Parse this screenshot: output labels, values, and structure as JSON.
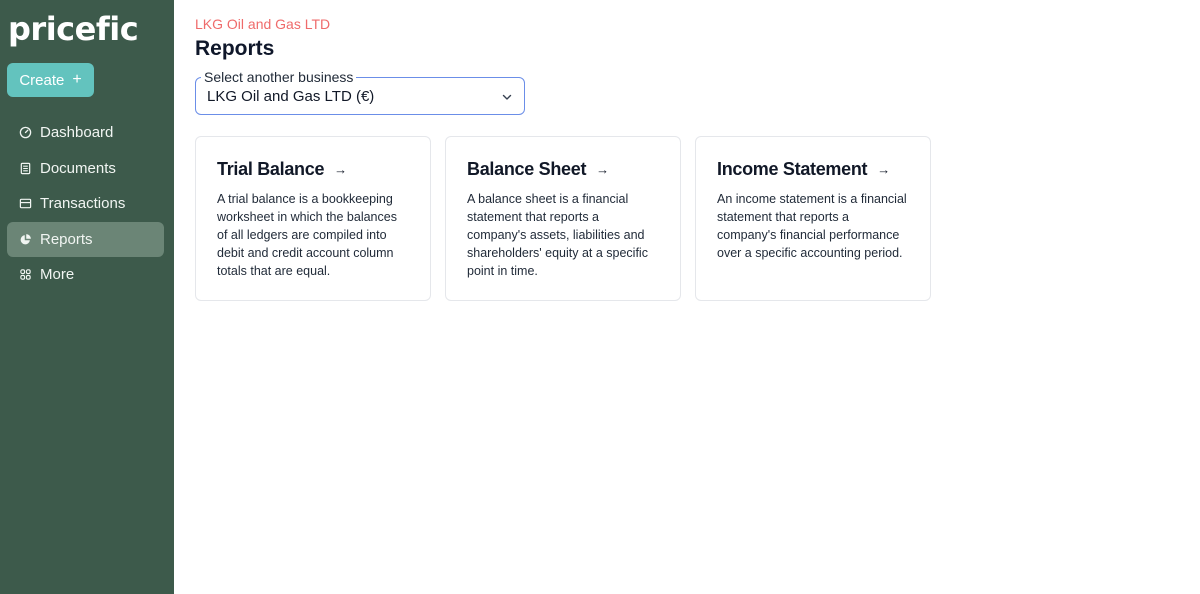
{
  "sidebar": {
    "logo": "pricefic",
    "create_label": "Create",
    "create_icon": "plus-icon",
    "items": [
      {
        "label": "Dashboard",
        "icon": "dashboard-gauge-icon",
        "active": false
      },
      {
        "label": "Documents",
        "icon": "document-icon",
        "active": false
      },
      {
        "label": "Transactions",
        "icon": "card-icon",
        "active": false
      },
      {
        "label": "Reports",
        "icon": "pie-chart-icon",
        "active": true
      },
      {
        "label": "More",
        "icon": "grid-icon",
        "active": false
      }
    ]
  },
  "main": {
    "business_name": "LKG Oil and Gas LTD",
    "title": "Reports",
    "select": {
      "legend": "Select another business",
      "value": "LKG Oil and Gas LTD (€)"
    },
    "cards": [
      {
        "title": "Trial Balance",
        "description": "A trial balance is a bookkeeping worksheet in which the balances of all ledgers are compiled into debit and credit account column totals that are equal."
      },
      {
        "title": "Balance Sheet",
        "description": "A balance sheet is a financial statement that reports a company's assets, liabilities and shareholders' equity at a specific point in time."
      },
      {
        "title": "Income Statement",
        "description": "An income statement is a financial statement that reports a company's financial performance over a specific accounting period."
      }
    ]
  },
  "colors": {
    "sidebar_bg": "#3d5a4b",
    "create_button": "#63c3be",
    "business_name": "#ef6b6b",
    "select_border": "#6b8ee8"
  }
}
